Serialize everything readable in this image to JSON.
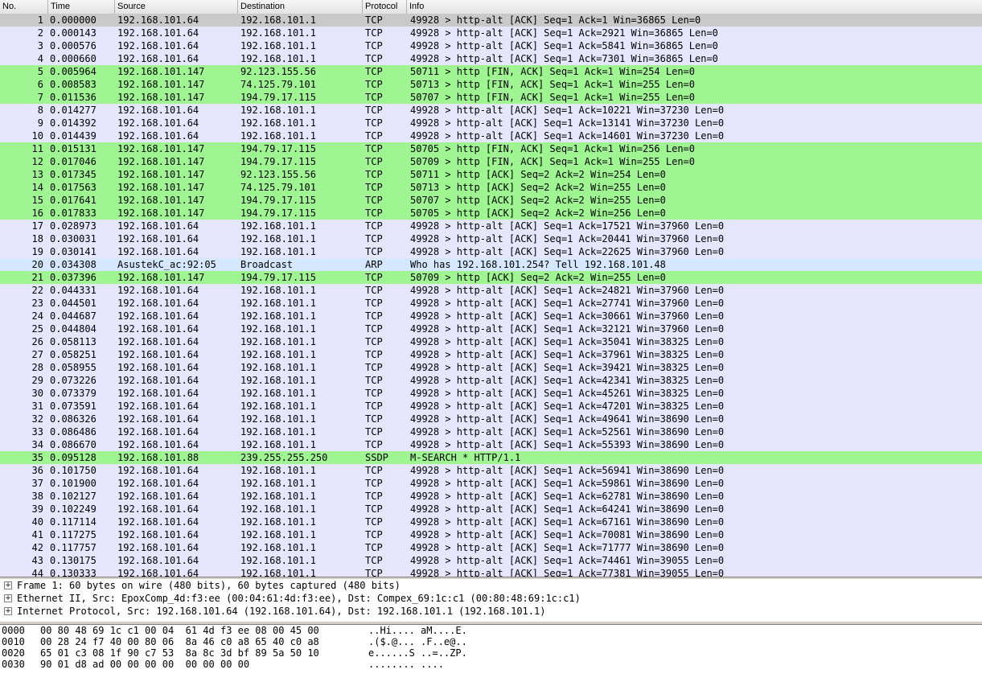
{
  "columns": {
    "no": "No.",
    "time": "Time",
    "source": "Source",
    "destination": "Destination",
    "protocol": "Protocol",
    "info": "Info"
  },
  "packets": [
    {
      "no": "1",
      "time": "0.000000",
      "src": "192.168.101.64",
      "dst": "192.168.101.1",
      "proto": "TCP",
      "info": "49928 > http-alt [ACK] Seq=1 Ack=1 Win=36865 Len=0",
      "style": "sel"
    },
    {
      "no": "2",
      "time": "0.000143",
      "src": "192.168.101.64",
      "dst": "192.168.101.1",
      "proto": "TCP",
      "info": "49928 > http-alt [ACK] Seq=1 Ack=2921 Win=36865 Len=0",
      "style": "tcp"
    },
    {
      "no": "3",
      "time": "0.000576",
      "src": "192.168.101.64",
      "dst": "192.168.101.1",
      "proto": "TCP",
      "info": "49928 > http-alt [ACK] Seq=1 Ack=5841 Win=36865 Len=0",
      "style": "tcp"
    },
    {
      "no": "4",
      "time": "0.000660",
      "src": "192.168.101.64",
      "dst": "192.168.101.1",
      "proto": "TCP",
      "info": "49928 > http-alt [ACK] Seq=1 Ack=7301 Win=36865 Len=0",
      "style": "tcp"
    },
    {
      "no": "5",
      "time": "0.005964",
      "src": "192.168.101.147",
      "dst": "92.123.155.56",
      "proto": "TCP",
      "info": "50711 > http [FIN, ACK] Seq=1 Ack=1 Win=254 Len=0",
      "style": "tcpflag"
    },
    {
      "no": "6",
      "time": "0.008583",
      "src": "192.168.101.147",
      "dst": "74.125.79.101",
      "proto": "TCP",
      "info": "50713 > http [FIN, ACK] Seq=1 Ack=1 Win=255 Len=0",
      "style": "tcpflag"
    },
    {
      "no": "7",
      "time": "0.011536",
      "src": "192.168.101.147",
      "dst": "194.79.17.115",
      "proto": "TCP",
      "info": "50707 > http [FIN, ACK] Seq=1 Ack=1 Win=255 Len=0",
      "style": "tcpflag"
    },
    {
      "no": "8",
      "time": "0.014277",
      "src": "192.168.101.64",
      "dst": "192.168.101.1",
      "proto": "TCP",
      "info": "49928 > http-alt [ACK] Seq=1 Ack=10221 Win=37230 Len=0",
      "style": "tcp"
    },
    {
      "no": "9",
      "time": "0.014392",
      "src": "192.168.101.64",
      "dst": "192.168.101.1",
      "proto": "TCP",
      "info": "49928 > http-alt [ACK] Seq=1 Ack=13141 Win=37230 Len=0",
      "style": "tcp"
    },
    {
      "no": "10",
      "time": "0.014439",
      "src": "192.168.101.64",
      "dst": "192.168.101.1",
      "proto": "TCP",
      "info": "49928 > http-alt [ACK] Seq=1 Ack=14601 Win=37230 Len=0",
      "style": "tcp"
    },
    {
      "no": "11",
      "time": "0.015131",
      "src": "192.168.101.147",
      "dst": "194.79.17.115",
      "proto": "TCP",
      "info": "50705 > http [FIN, ACK] Seq=1 Ack=1 Win=256 Len=0",
      "style": "tcpflag"
    },
    {
      "no": "12",
      "time": "0.017046",
      "src": "192.168.101.147",
      "dst": "194.79.17.115",
      "proto": "TCP",
      "info": "50709 > http [FIN, ACK] Seq=1 Ack=1 Win=255 Len=0",
      "style": "tcpflag"
    },
    {
      "no": "13",
      "time": "0.017345",
      "src": "192.168.101.147",
      "dst": "92.123.155.56",
      "proto": "TCP",
      "info": "50711 > http [ACK] Seq=2 Ack=2 Win=254 Len=0",
      "style": "tcpflag"
    },
    {
      "no": "14",
      "time": "0.017563",
      "src": "192.168.101.147",
      "dst": "74.125.79.101",
      "proto": "TCP",
      "info": "50713 > http [ACK] Seq=2 Ack=2 Win=255 Len=0",
      "style": "tcpflag"
    },
    {
      "no": "15",
      "time": "0.017641",
      "src": "192.168.101.147",
      "dst": "194.79.17.115",
      "proto": "TCP",
      "info": "50707 > http [ACK] Seq=2 Ack=2 Win=255 Len=0",
      "style": "tcpflag"
    },
    {
      "no": "16",
      "time": "0.017833",
      "src": "192.168.101.147",
      "dst": "194.79.17.115",
      "proto": "TCP",
      "info": "50705 > http [ACK] Seq=2 Ack=2 Win=256 Len=0",
      "style": "tcpflag"
    },
    {
      "no": "17",
      "time": "0.028973",
      "src": "192.168.101.64",
      "dst": "192.168.101.1",
      "proto": "TCP",
      "info": "49928 > http-alt [ACK] Seq=1 Ack=17521 Win=37960 Len=0",
      "style": "tcp"
    },
    {
      "no": "18",
      "time": "0.030031",
      "src": "192.168.101.64",
      "dst": "192.168.101.1",
      "proto": "TCP",
      "info": "49928 > http-alt [ACK] Seq=1 Ack=20441 Win=37960 Len=0",
      "style": "tcp"
    },
    {
      "no": "19",
      "time": "0.030141",
      "src": "192.168.101.64",
      "dst": "192.168.101.1",
      "proto": "TCP",
      "info": "49928 > http-alt [ACK] Seq=1 Ack=22625 Win=37960 Len=0",
      "style": "tcp"
    },
    {
      "no": "20",
      "time": "0.034308",
      "src": "AsustekC_ac:92:05",
      "dst": "Broadcast",
      "proto": "ARP",
      "info": "Who has 192.168.101.254?  Tell 192.168.101.48",
      "style": "arp"
    },
    {
      "no": "21",
      "time": "0.037396",
      "src": "192.168.101.147",
      "dst": "194.79.17.115",
      "proto": "TCP",
      "info": "50709 > http [ACK] Seq=2 Ack=2 Win=255 Len=0",
      "style": "tcpflag"
    },
    {
      "no": "22",
      "time": "0.044331",
      "src": "192.168.101.64",
      "dst": "192.168.101.1",
      "proto": "TCP",
      "info": "49928 > http-alt [ACK] Seq=1 Ack=24821 Win=37960 Len=0",
      "style": "tcp"
    },
    {
      "no": "23",
      "time": "0.044501",
      "src": "192.168.101.64",
      "dst": "192.168.101.1",
      "proto": "TCP",
      "info": "49928 > http-alt [ACK] Seq=1 Ack=27741 Win=37960 Len=0",
      "style": "tcp"
    },
    {
      "no": "24",
      "time": "0.044687",
      "src": "192.168.101.64",
      "dst": "192.168.101.1",
      "proto": "TCP",
      "info": "49928 > http-alt [ACK] Seq=1 Ack=30661 Win=37960 Len=0",
      "style": "tcp"
    },
    {
      "no": "25",
      "time": "0.044804",
      "src": "192.168.101.64",
      "dst": "192.168.101.1",
      "proto": "TCP",
      "info": "49928 > http-alt [ACK] Seq=1 Ack=32121 Win=37960 Len=0",
      "style": "tcp"
    },
    {
      "no": "26",
      "time": "0.058113",
      "src": "192.168.101.64",
      "dst": "192.168.101.1",
      "proto": "TCP",
      "info": "49928 > http-alt [ACK] Seq=1 Ack=35041 Win=38325 Len=0",
      "style": "tcp"
    },
    {
      "no": "27",
      "time": "0.058251",
      "src": "192.168.101.64",
      "dst": "192.168.101.1",
      "proto": "TCP",
      "info": "49928 > http-alt [ACK] Seq=1 Ack=37961 Win=38325 Len=0",
      "style": "tcp"
    },
    {
      "no": "28",
      "time": "0.058955",
      "src": "192.168.101.64",
      "dst": "192.168.101.1",
      "proto": "TCP",
      "info": "49928 > http-alt [ACK] Seq=1 Ack=39421 Win=38325 Len=0",
      "style": "tcp"
    },
    {
      "no": "29",
      "time": "0.073226",
      "src": "192.168.101.64",
      "dst": "192.168.101.1",
      "proto": "TCP",
      "info": "49928 > http-alt [ACK] Seq=1 Ack=42341 Win=38325 Len=0",
      "style": "tcp"
    },
    {
      "no": "30",
      "time": "0.073379",
      "src": "192.168.101.64",
      "dst": "192.168.101.1",
      "proto": "TCP",
      "info": "49928 > http-alt [ACK] Seq=1 Ack=45261 Win=38325 Len=0",
      "style": "tcp"
    },
    {
      "no": "31",
      "time": "0.073591",
      "src": "192.168.101.64",
      "dst": "192.168.101.1",
      "proto": "TCP",
      "info": "49928 > http-alt [ACK] Seq=1 Ack=47201 Win=38325 Len=0",
      "style": "tcp"
    },
    {
      "no": "32",
      "time": "0.086326",
      "src": "192.168.101.64",
      "dst": "192.168.101.1",
      "proto": "TCP",
      "info": "49928 > http-alt [ACK] Seq=1 Ack=49641 Win=38690 Len=0",
      "style": "tcp"
    },
    {
      "no": "33",
      "time": "0.086486",
      "src": "192.168.101.64",
      "dst": "192.168.101.1",
      "proto": "TCP",
      "info": "49928 > http-alt [ACK] Seq=1 Ack=52561 Win=38690 Len=0",
      "style": "tcp"
    },
    {
      "no": "34",
      "time": "0.086670",
      "src": "192.168.101.64",
      "dst": "192.168.101.1",
      "proto": "TCP",
      "info": "49928 > http-alt [ACK] Seq=1 Ack=55393 Win=38690 Len=0",
      "style": "tcp"
    },
    {
      "no": "35",
      "time": "0.095128",
      "src": "192.168.101.88",
      "dst": "239.255.255.250",
      "proto": "SSDP",
      "info": "M-SEARCH * HTTP/1.1",
      "style": "ssdp"
    },
    {
      "no": "36",
      "time": "0.101750",
      "src": "192.168.101.64",
      "dst": "192.168.101.1",
      "proto": "TCP",
      "info": "49928 > http-alt [ACK] Seq=1 Ack=56941 Win=38690 Len=0",
      "style": "tcp"
    },
    {
      "no": "37",
      "time": "0.101900",
      "src": "192.168.101.64",
      "dst": "192.168.101.1",
      "proto": "TCP",
      "info": "49928 > http-alt [ACK] Seq=1 Ack=59861 Win=38690 Len=0",
      "style": "tcp"
    },
    {
      "no": "38",
      "time": "0.102127",
      "src": "192.168.101.64",
      "dst": "192.168.101.1",
      "proto": "TCP",
      "info": "49928 > http-alt [ACK] Seq=1 Ack=62781 Win=38690 Len=0",
      "style": "tcp"
    },
    {
      "no": "39",
      "time": "0.102249",
      "src": "192.168.101.64",
      "dst": "192.168.101.1",
      "proto": "TCP",
      "info": "49928 > http-alt [ACK] Seq=1 Ack=64241 Win=38690 Len=0",
      "style": "tcp"
    },
    {
      "no": "40",
      "time": "0.117114",
      "src": "192.168.101.64",
      "dst": "192.168.101.1",
      "proto": "TCP",
      "info": "49928 > http-alt [ACK] Seq=1 Ack=67161 Win=38690 Len=0",
      "style": "tcp"
    },
    {
      "no": "41",
      "time": "0.117275",
      "src": "192.168.101.64",
      "dst": "192.168.101.1",
      "proto": "TCP",
      "info": "49928 > http-alt [ACK] Seq=1 Ack=70081 Win=38690 Len=0",
      "style": "tcp"
    },
    {
      "no": "42",
      "time": "0.117757",
      "src": "192.168.101.64",
      "dst": "192.168.101.1",
      "proto": "TCP",
      "info": "49928 > http-alt [ACK] Seq=1 Ack=71777 Win=38690 Len=0",
      "style": "tcp"
    },
    {
      "no": "43",
      "time": "0.130175",
      "src": "192.168.101.64",
      "dst": "192.168.101.1",
      "proto": "TCP",
      "info": "49928 > http-alt [ACK] Seq=1 Ack=74461 Win=39055 Len=0",
      "style": "tcp"
    },
    {
      "no": "44",
      "time": "0.130333",
      "src": "192.168.101.64",
      "dst": "192.168.101.1",
      "proto": "TCP",
      "info": "49928 > http-alt [ACK] Seq=1 Ack=77381 Win=39055 Len=0",
      "style": "tcp"
    }
  ],
  "details": [
    {
      "expander": "+",
      "text": "Frame 1: 60 bytes on wire (480 bits), 60 bytes captured (480 bits)"
    },
    {
      "expander": "+",
      "text": "Ethernet II, Src: EpoxComp_4d:f3:ee (00:04:61:4d:f3:ee), Dst: Compex_69:1c:c1 (00:80:48:69:1c:c1)"
    },
    {
      "expander": "+",
      "text": "Internet Protocol, Src: 192.168.101.64 (192.168.101.64), Dst: 192.168.101.1 (192.168.101.1)"
    }
  ],
  "bytes": [
    {
      "offset": "0000",
      "hex": "00 80 48 69 1c c1 00 04  61 4d f3 ee 08 00 45 00",
      "ascii": "..Hi.... aM....E."
    },
    {
      "offset": "0010",
      "hex": "00 28 24 f7 40 00 80 06  8a 46 c0 a8 65 40 c0 a8",
      "ascii": ".($.@... .F..e@.."
    },
    {
      "offset": "0020",
      "hex": "65 01 c3 08 1f 90 c7 53  8a 8c 3d bf 89 5a 50 10",
      "ascii": "e......S ..=..ZP."
    },
    {
      "offset": "0030",
      "hex": "90 01 d8 ad 00 00 00 00  00 00 00 00",
      "ascii": "........ ...."
    }
  ]
}
